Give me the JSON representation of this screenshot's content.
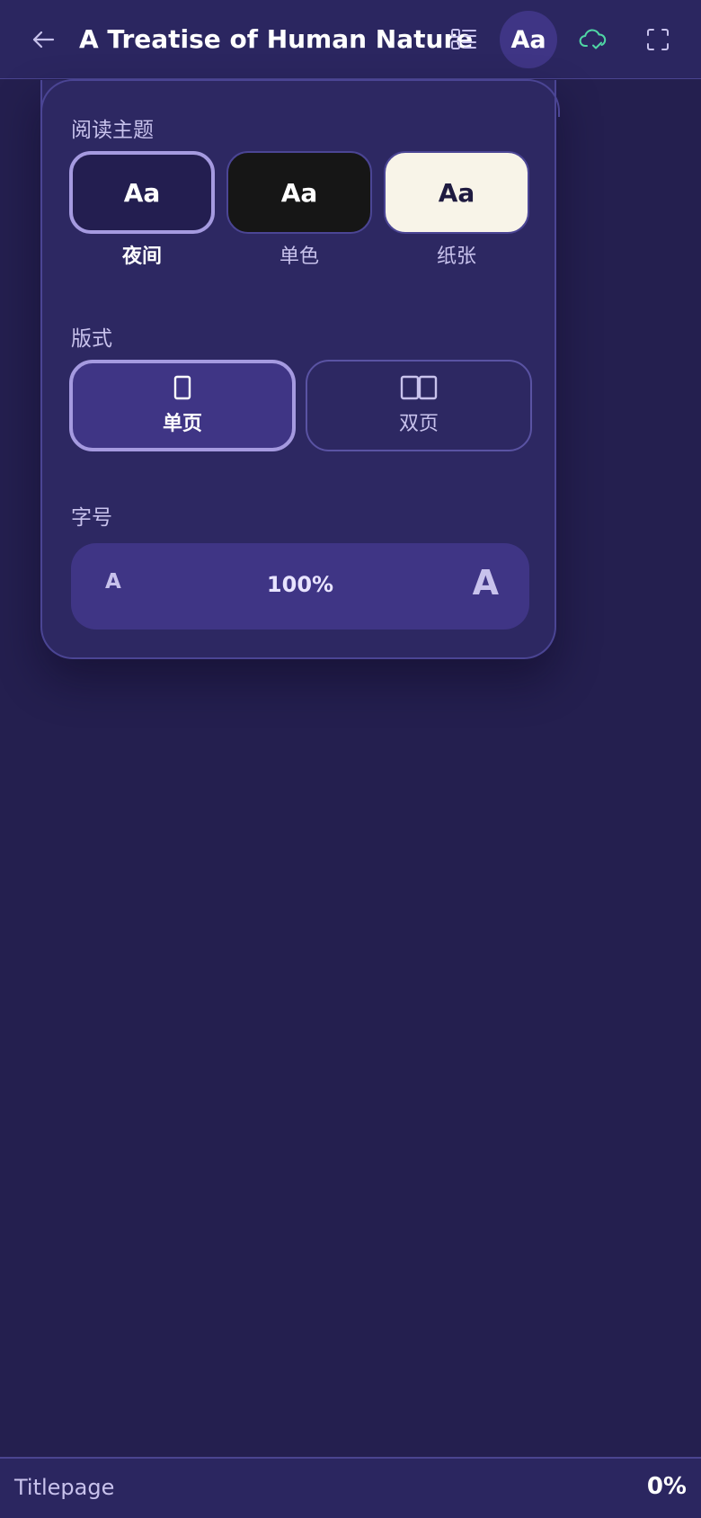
{
  "header": {
    "title": "A Treatise of Human Nature",
    "font_button_label": "Aa",
    "icons": {
      "back": "arrow-left-icon",
      "toc": "list-icon",
      "sync": "cloud-check-icon",
      "fullscreen": "expand-icon"
    }
  },
  "settings": {
    "theme": {
      "label": "阅读主题",
      "options": [
        {
          "preview": "Aa",
          "label": "夜间",
          "selected": true,
          "color": "#231e50"
        },
        {
          "preview": "Aa",
          "label": "单色",
          "selected": false,
          "color": "#161616"
        },
        {
          "preview": "Aa",
          "label": "纸张",
          "selected": false,
          "color": "#f8f4e8"
        }
      ]
    },
    "layout": {
      "label": "版式",
      "options": [
        {
          "label": "单页",
          "icon": "single-page-icon",
          "selected": true
        },
        {
          "label": "双页",
          "icon": "double-page-icon",
          "selected": false
        }
      ]
    },
    "font_size": {
      "label": "字号",
      "decrease": "A",
      "value": "100%",
      "increase": "A"
    }
  },
  "footer": {
    "chapter": "Titlepage",
    "progress": "0%"
  },
  "colors": {
    "background": "#241f4f",
    "panel": "#2d2862",
    "accent": "#a59ae0",
    "sync_icon": "#4fd6a4"
  }
}
